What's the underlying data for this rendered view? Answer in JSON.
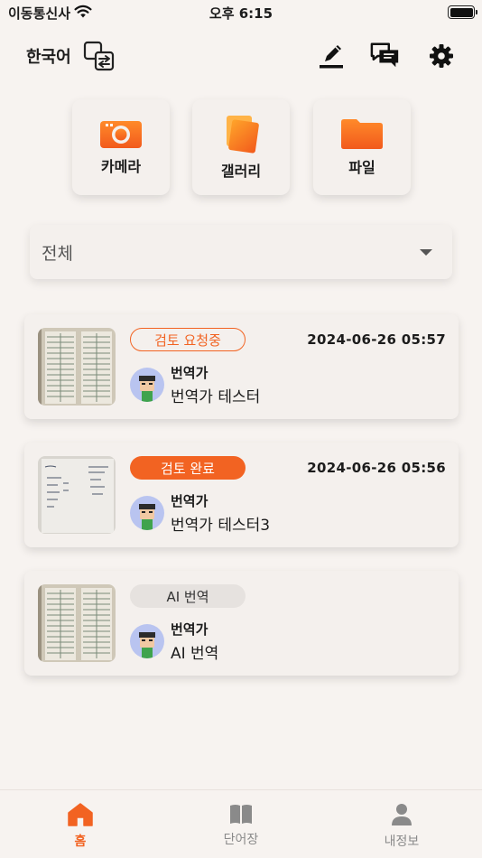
{
  "status_bar": {
    "carrier": "이동통신사",
    "time": "오후 6:15"
  },
  "header": {
    "language": "한국어",
    "icons": [
      "language-switch-icon",
      "pen-icon",
      "chat-icon",
      "gear-icon"
    ]
  },
  "sources": [
    {
      "label": "카메라",
      "icon": "camera-icon"
    },
    {
      "label": "갤러리",
      "icon": "gallery-icon"
    },
    {
      "label": "파일",
      "icon": "folder-icon"
    }
  ],
  "filter": {
    "value": "전체"
  },
  "cards": [
    {
      "status": "검토 요청중",
      "status_style": "outline",
      "date": "2024-06-26 05:57",
      "role": "번역가",
      "name": "번역가 테스터"
    },
    {
      "status": "검토 완료",
      "status_style": "filled",
      "date": "2024-06-26 05:56",
      "role": "번역가",
      "name": "번역가 테스터3"
    },
    {
      "status": "AI 번역",
      "status_style": "grey",
      "date": "",
      "role": "번역가",
      "name": "AI 번역"
    }
  ],
  "tabs": [
    {
      "label": "홈",
      "icon": "home-icon",
      "active": true
    },
    {
      "label": "단어장",
      "icon": "book-icon",
      "active": false
    },
    {
      "label": "내정보",
      "icon": "person-icon",
      "active": false
    }
  ],
  "colors": {
    "accent": "#f26322",
    "background": "#f7f3f0",
    "card": "#f4f0ed",
    "avatar": "#b9c4f0"
  }
}
